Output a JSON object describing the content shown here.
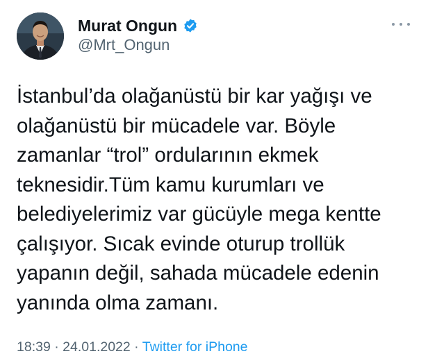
{
  "author": {
    "display_name": "Murat Ongun",
    "handle": "@Mrt_Ongun",
    "verified": true
  },
  "icons": {
    "avatar": "profile-photo",
    "verified": "verified-badge-icon",
    "more": "more-options-icon"
  },
  "tweet": {
    "lines": [
      "İstanbul’da olağanüstü bir kar yağışı ve",
      "olağanüstü bir mücadele var. Böyle",
      "zamanlar “trol” ordularının ekmek",
      "teknesidir.Tüm kamu kurumları ve",
      "belediyelerimiz var gücüyle mega kentte",
      "çalışıyor. Sıcak evinde oturup trollük",
      "yapanın değil, sahada mücadele edenin",
      "yanında olma zamanı."
    ]
  },
  "meta": {
    "time": "18:39",
    "separator": " · ",
    "date": "24.01.2022",
    "source": "Twitter for iPhone"
  },
  "colors": {
    "text": "#0f1419",
    "secondary": "#536471",
    "accent": "#1d9bf0"
  }
}
